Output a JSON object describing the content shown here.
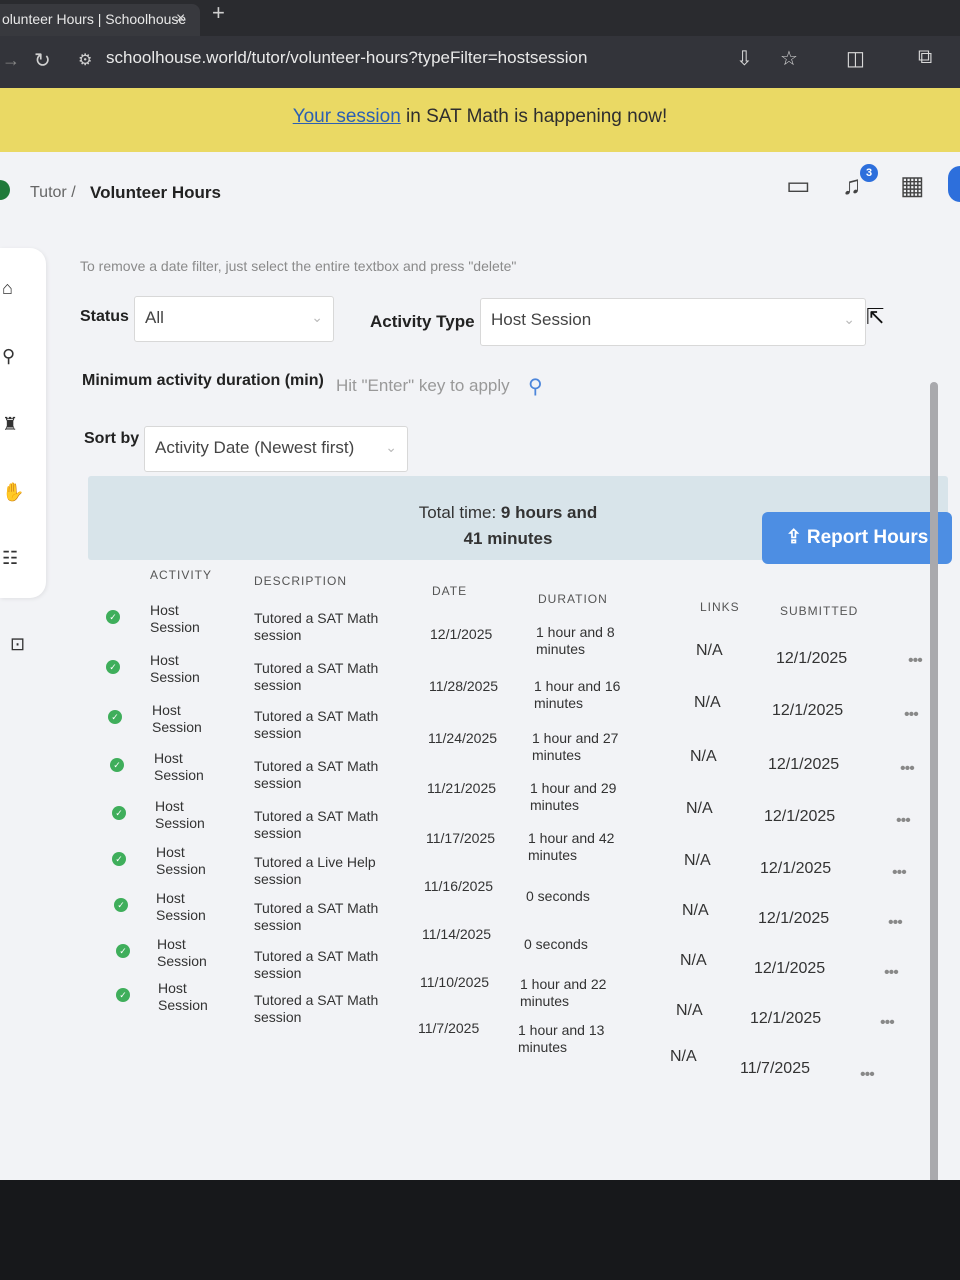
{
  "browser": {
    "tab_title": "olunteer Hours | Schoolhouse",
    "tab_close": "×",
    "new_tab": "+",
    "url": "schoolhouse.world/tutor/volunteer-hours?typeFilter=hostsession"
  },
  "banner": {
    "link_text": "Your session",
    "rest_text": " in SAT Math is happening now!"
  },
  "header": {
    "breadcrumb_parent": "Tutor /",
    "breadcrumb_current": "Volunteer Hours",
    "notification_count": "3"
  },
  "filters": {
    "hint": "To remove a date filter, just select the entire textbox and press \"delete\"",
    "status_label": "Status",
    "status_value": "All",
    "activity_type_label": "Activity Type",
    "activity_type_value": "Host Session",
    "min_duration_label": "Minimum activity duration (min)",
    "min_duration_placeholder": "Hit \"Enter\" key to apply",
    "sort_label": "Sort by",
    "sort_value": "Activity Date (Newest first)"
  },
  "summary": {
    "total_prefix": "Total time: ",
    "total_value": "9 hours and 41 minutes",
    "report_button": "Report Hours"
  },
  "table": {
    "headers": [
      "ACTIVITY",
      "DESCRIPTION",
      "DATE",
      "DURATION",
      "LINKS",
      "SUBMITTED"
    ],
    "rows": [
      {
        "activity": "Host Session",
        "description": "Tutored a SAT Math session",
        "date": "12/1/2025",
        "duration": "1 hour and 8 minutes",
        "links": "N/A",
        "submitted": "12/1/2025",
        "more": "•••"
      },
      {
        "activity": "Host Session",
        "description": "Tutored a SAT Math session",
        "date": "11/28/2025",
        "duration": "1 hour and 16 minutes",
        "links": "N/A",
        "submitted": "12/1/2025",
        "more": "•••"
      },
      {
        "activity": "Host Session",
        "description": "Tutored a SAT Math session",
        "date": "11/24/2025",
        "duration": "1 hour and 27 minutes",
        "links": "N/A",
        "submitted": "12/1/2025",
        "more": "•••"
      },
      {
        "activity": "Host Session",
        "description": "Tutored a SAT Math session",
        "date": "11/21/2025",
        "duration": "1 hour and 29 minutes",
        "links": "N/A",
        "submitted": "12/1/2025",
        "more": "•••"
      },
      {
        "activity": "Host Session",
        "description": "Tutored a SAT Math session",
        "date": "11/17/2025",
        "duration": "1 hour and 42 minutes",
        "links": "N/A",
        "submitted": "12/1/2025",
        "more": "•••"
      },
      {
        "activity": "Host Session",
        "description": "Tutored a Live Help session",
        "date": "11/16/2025",
        "duration": "0 seconds",
        "links": "N/A",
        "submitted": "12/1/2025",
        "more": "•••"
      },
      {
        "activity": "Host Session",
        "description": "Tutored a SAT Math session",
        "date": "11/14/2025",
        "duration": "0 seconds",
        "links": "N/A",
        "submitted": "12/1/2025",
        "more": "•••"
      },
      {
        "activity": "Host Session",
        "description": "Tutored a SAT Math session",
        "date": "11/10/2025",
        "duration": "1 hour and 22 minutes",
        "links": "N/A",
        "submitted": "12/1/2025",
        "more": "•••"
      },
      {
        "activity": "Host Session",
        "description": "Tutored a SAT Math session",
        "date": "11/7/2025",
        "duration": "1 hour and 13 minutes",
        "links": "N/A",
        "submitted": "11/7/2025",
        "more": "•••"
      }
    ]
  },
  "colors": {
    "banner": "#ead964",
    "accent": "#4d8ee3",
    "success": "#3fae5b"
  },
  "icons": [
    "back-icon",
    "reload-icon",
    "site-settings-icon",
    "install-icon",
    "star-icon",
    "extensions-icon",
    "lens-icon",
    "chat-icon",
    "bell-icon",
    "calendar-icon",
    "home-icon",
    "search-icon",
    "graduation-cap-icon",
    "hand-icon",
    "people-icon",
    "teacher-icon",
    "upload-icon",
    "check-icon",
    "more-icon",
    "windows-icon",
    "folder-icon",
    "settings-icon",
    "chrome-icon",
    "steam-icon",
    "discord-icon",
    "figma-icon",
    "android-studio-icon",
    "unity-icon",
    "vscode-icon",
    "blender-icon"
  ]
}
